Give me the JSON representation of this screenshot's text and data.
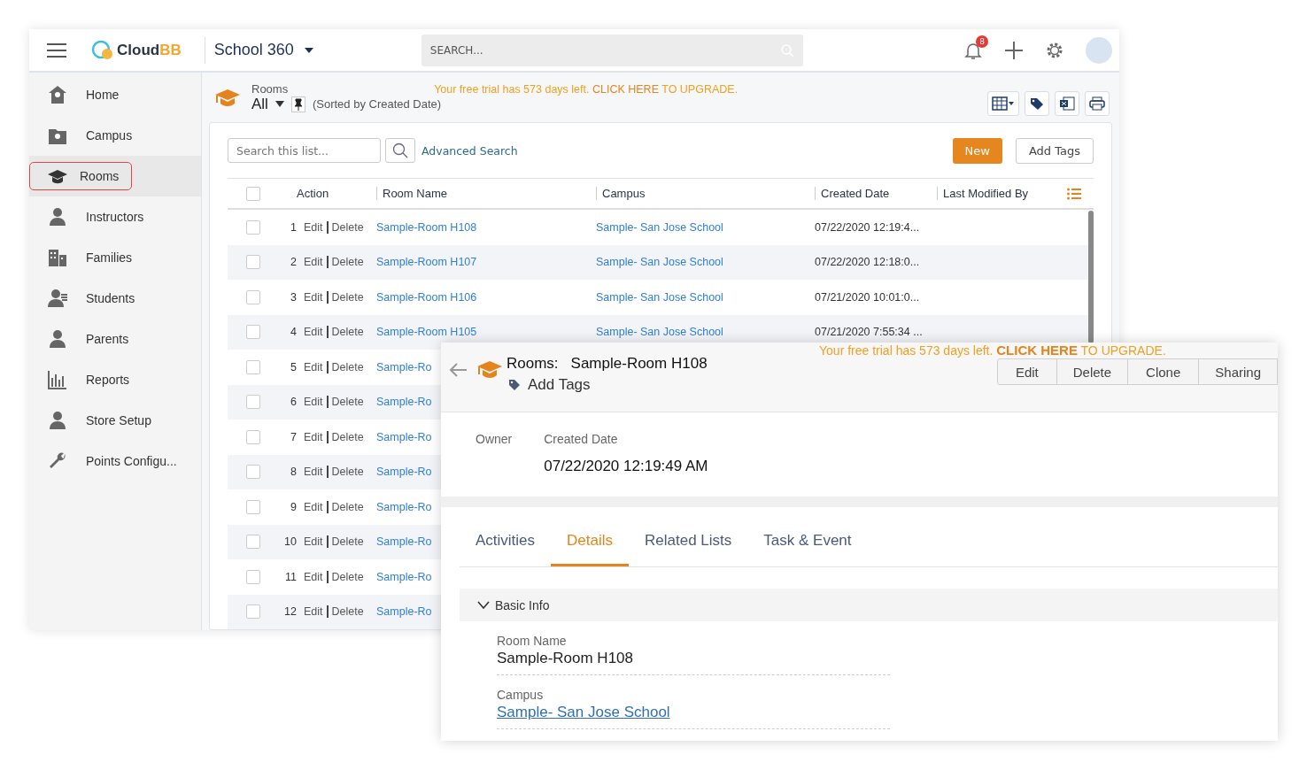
{
  "header": {
    "logo": {
      "part1": "Cloud",
      "part2": "BB"
    },
    "app_title": "School 360",
    "search": {
      "placeholder": "SEARCH..."
    },
    "notifications": {
      "count": "8"
    }
  },
  "sidebar": {
    "items": [
      {
        "label": "Home",
        "kind": "home",
        "selected": false
      },
      {
        "label": "Campus",
        "kind": "campus",
        "selected": false
      },
      {
        "label": "Rooms",
        "kind": "cap",
        "selected": true
      },
      {
        "label": "Instructors",
        "kind": "person",
        "selected": false
      },
      {
        "label": "Families",
        "kind": "building",
        "selected": false
      },
      {
        "label": "Students",
        "kind": "student",
        "selected": false
      },
      {
        "label": "Parents",
        "kind": "person",
        "selected": false
      },
      {
        "label": "Reports",
        "kind": "chart",
        "selected": false
      },
      {
        "label": "Store Setup",
        "kind": "person",
        "selected": false
      },
      {
        "label": "Points Configu...",
        "kind": "wrench",
        "selected": false
      }
    ]
  },
  "list_header": {
    "object": "Rooms",
    "view": "All",
    "sort_note": "(Sorted by Created Date)",
    "trial": {
      "before": "Your free trial has 573 days left. ",
      "link": "CLICK HERE",
      "after": " TO UPGRADE."
    }
  },
  "list": {
    "search": {
      "placeholder": "Search this list..."
    },
    "advanced_search": "Advanced Search",
    "buttons": {
      "new": "New",
      "add_tags": "Add Tags"
    },
    "columns": [
      "Action",
      "Room Name",
      "Campus",
      "Created Date",
      "Last Modified By"
    ],
    "header_checked": false,
    "rows": [
      {
        "number": "1",
        "actions": [
          "Edit",
          "Delete"
        ],
        "room": "Sample-Room H108",
        "campus": "Sample- San Jose School",
        "created": "07/22/2020 12:19:4...",
        "checked": false
      },
      {
        "number": "2",
        "actions": [
          "Edit",
          "Delete"
        ],
        "room": "Sample-Room H107",
        "campus": "Sample- San Jose School",
        "created": "07/22/2020 12:18:0...",
        "checked": false
      },
      {
        "number": "3",
        "actions": [
          "Edit",
          "Delete"
        ],
        "room": "Sample-Room H106",
        "campus": "Sample- San Jose School",
        "created": "07/21/2020 10:01:0...",
        "checked": false
      },
      {
        "number": "4",
        "actions": [
          "Edit",
          "Delete"
        ],
        "room": "Sample-Room H105",
        "campus": "Sample- San Jose School",
        "created": "07/21/2020 7:55:34 ...",
        "checked": false
      },
      {
        "number": "5",
        "actions": [
          "Edit",
          "Delete"
        ],
        "room": "Sample-Ro",
        "checked": false
      },
      {
        "number": "6",
        "actions": [
          "Edit",
          "Delete"
        ],
        "room": "Sample-Ro",
        "checked": false
      },
      {
        "number": "7",
        "actions": [
          "Edit",
          "Delete"
        ],
        "room": "Sample-Ro",
        "checked": false
      },
      {
        "number": "8",
        "actions": [
          "Edit",
          "Delete"
        ],
        "room": "Sample-Ro",
        "checked": false
      },
      {
        "number": "9",
        "actions": [
          "Edit",
          "Delete"
        ],
        "room": "Sample-Ro",
        "checked": false
      },
      {
        "number": "10",
        "actions": [
          "Edit",
          "Delete"
        ],
        "room": "Sample-Ro",
        "checked": false
      },
      {
        "number": "11",
        "actions": [
          "Edit",
          "Delete"
        ],
        "room": "Sample-Ro",
        "checked": false
      },
      {
        "number": "12",
        "actions": [
          "Edit",
          "Delete"
        ],
        "room": "Sample-Ro",
        "checked": false
      }
    ]
  },
  "detail": {
    "object": "Rooms:",
    "record": "Sample-Room H108",
    "add_tags": "Add Tags",
    "trial": {
      "before": "Your free trial has 573 days left. ",
      "link": "CLICK HERE",
      "after": " TO UPGRADE."
    },
    "buttons": [
      "Edit",
      "Delete",
      "Clone",
      "Sharing"
    ],
    "summary": [
      {
        "label": "Owner"
      },
      {
        "label": "Created Date",
        "value": "07/22/2020 12:19:49 AM"
      }
    ],
    "tabs": [
      {
        "label": "Activities",
        "selected": false
      },
      {
        "label": "Details",
        "selected": true
      },
      {
        "label": "Related Lists",
        "selected": false
      },
      {
        "label": "Task & Event",
        "selected": false
      }
    ],
    "section": {
      "title": "Basic Info",
      "expanded": true,
      "fields": [
        {
          "label": "Room Name",
          "value": "Sample-Room H108",
          "kind": "text"
        },
        {
          "label": "Campus",
          "value": "Sample- San Jose School",
          "kind": "link"
        }
      ]
    }
  }
}
